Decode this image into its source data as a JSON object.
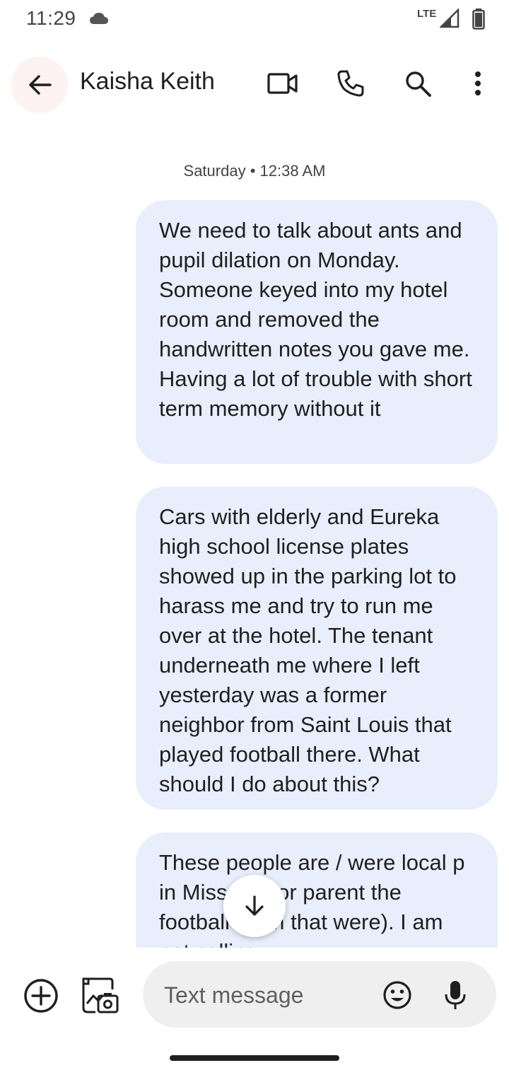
{
  "status_bar": {
    "time": "11:29",
    "network": "LTE",
    "icons": [
      "cloud-icon",
      "signal-icon",
      "battery-icon"
    ]
  },
  "app_bar": {
    "contact_name": "Kaisha Keith",
    "icons": [
      "back-arrow-icon",
      "video-call-icon",
      "phone-icon",
      "search-icon",
      "more-vert-icon"
    ]
  },
  "conversation": {
    "timestamp_day": "Saturday",
    "timestamp_sep": " • ",
    "timestamp_time": "12:38 AM",
    "messages": [
      {
        "text": "We need to talk about ants and pupil dilation on Monday. Someone keyed into my hotel room and removed the handwritten notes you gave me. Having a lot of trouble with short term memory without it"
      },
      {
        "text": "Cars with elderly and Eureka high school license plates showed up in the parking lot to harass me and try to run me over at the hotel. The tenant underneath me where I left yesterday was a former neighbor from Saint Louis that played football there. What should I do about this?"
      },
      {
        "text": "These people are / were local p      in Missouri (or parent      the football team that were). I am not calling"
      }
    ]
  },
  "compose": {
    "placeholder": "Text message",
    "value": ""
  },
  "colors": {
    "bubble_bg": "#e8eefb",
    "back_button_bg": "#fdf1f2",
    "compose_bg": "#efefef"
  }
}
